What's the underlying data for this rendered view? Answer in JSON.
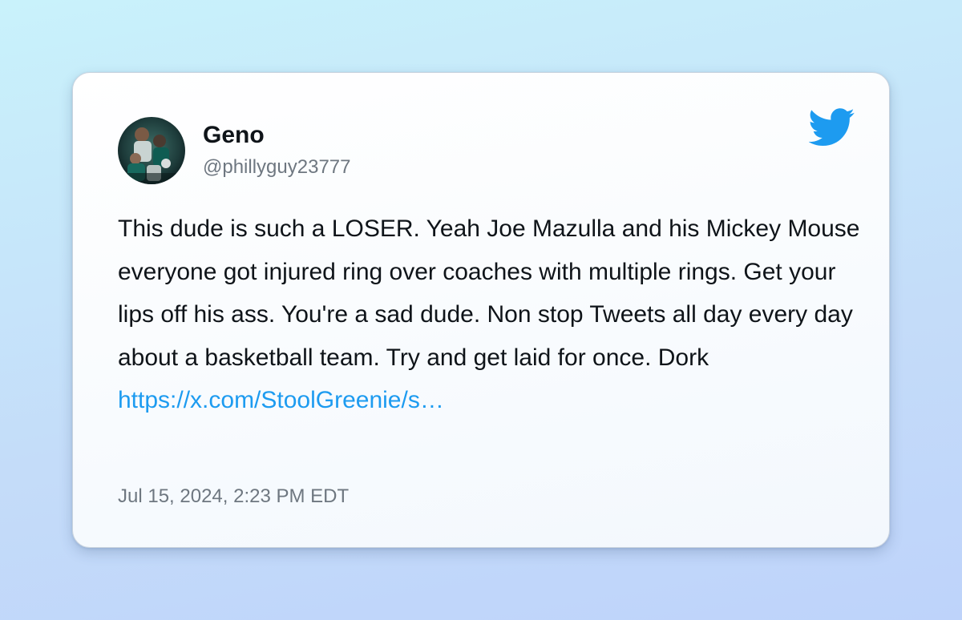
{
  "tweet": {
    "author": {
      "name": "Geno",
      "handle": "@phillyguy23777",
      "avatar_icon": "user-avatar-photo"
    },
    "brand_icon": "twitter-bird-icon",
    "brand_color": "#1d9bf0",
    "body": "This dude is such a LOSER. Yeah Joe Mazulla and his Mickey Mouse everyone got injured ring over coaches with multiple rings. Get your lips off his ass. You're a sad dude. Non stop Tweets all day every day about a basketball team. Try and get laid for once. Dork",
    "link": "https://x.com/StoolGreenie/s…",
    "timestamp": "Jul 15, 2024, 2:23 PM EDT"
  },
  "colors": {
    "background_top": "#c9f2fb",
    "background_bottom": "#bed3fa",
    "text": "#0f1419",
    "muted_text": "#6e7780"
  }
}
